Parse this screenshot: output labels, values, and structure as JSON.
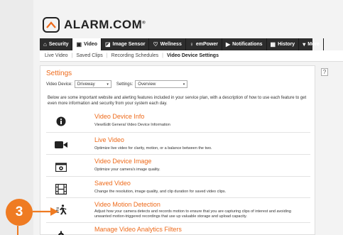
{
  "brand": {
    "name": "ALARM.COM",
    "registered": "®"
  },
  "nav": [
    {
      "label": "Security",
      "icon": "⌂"
    },
    {
      "label": "Video",
      "icon": "▣",
      "active": true
    },
    {
      "label": "Image Sensor",
      "icon": "◪"
    },
    {
      "label": "Wellness",
      "icon": "♡"
    },
    {
      "label": "emPower",
      "icon": "♀"
    },
    {
      "label": "Notifications",
      "icon": "▶"
    },
    {
      "label": "History",
      "icon": "▦"
    },
    {
      "label": "More",
      "icon": "▾"
    }
  ],
  "subnav": {
    "items": [
      "Live Video",
      "Saved Clips",
      "Recording Schedules",
      "Video Device Settings"
    ],
    "current": "Video Device Settings"
  },
  "help": "?",
  "panel": {
    "title": "Settings",
    "video_device_label": "Video Device:",
    "video_device_value": "Driveway",
    "settings_label": "Settings:",
    "settings_value": "Overview",
    "intro": "Below are some important website and alerting features included in your service plan, with a description of how to use each feature to get even more information and security from your system each day."
  },
  "rows": [
    {
      "title": "Video Device Info",
      "desc": "View/Edit General Video Device Information",
      "icon": "info-icon"
    },
    {
      "title": "Live Video",
      "desc": "Optimize live video for clarity, motion, or a balance between the two.",
      "icon": "video-camera-icon"
    },
    {
      "title": "Video Device Image",
      "desc": "Optimize your camera's image quality.",
      "icon": "camera-icon"
    },
    {
      "title": "Saved Video",
      "desc": "Change the resolution, image quality, and clip duration for saved video clips.",
      "icon": "film-icon"
    },
    {
      "title": "Video Motion Detection",
      "desc": "Adjust how your camera detects and records motion to ensure that you are capturing clips of interest and avoiding unwanted motion-triggered recordings that use up valuable storage and upload capacity.",
      "icon": "running-person-icon"
    },
    {
      "title": "Manage Video Analytics Filters",
      "desc": "",
      "icon": "gear-icon"
    }
  ],
  "callout": {
    "number": "3",
    "color": "#ef7b22"
  },
  "colors": {
    "accent": "#ee6a1a",
    "nav_bg": "#2d2d2d"
  }
}
